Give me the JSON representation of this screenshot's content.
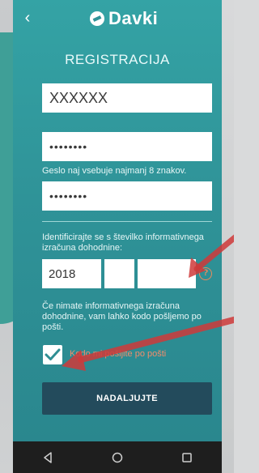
{
  "app": {
    "logo_text": "Davki",
    "screen_title": "REGISTRACIJA"
  },
  "form": {
    "username_value": "XXXXXX",
    "password_value": "••••••••",
    "password_hint": "Geslo naj vsebuje najmanj 8 znakov.",
    "password_repeat_value": "••••••••",
    "identify_text": "Identificirajte se s številko informativnega izračuna dohodnine:",
    "year_value": "2018",
    "code_part_small_value": "",
    "code_part_mid_value": "",
    "help_icon_glyph": "?",
    "note_text": "Če nimate informativnega izračuna dohodnine, vam lahko kodo pošljemo po pošti.",
    "checkbox_checked": true,
    "checkbox_label": "Kodo mi pošljite po pošti",
    "continue_label": "NADALJUJTE"
  },
  "colors": {
    "accent_teal": "#2f9398",
    "button_dark": "#234b5c",
    "label_orange": "#f28c6b",
    "annotation_red": "#cf3a3a"
  },
  "icons": {
    "back": "back-icon",
    "help": "help-icon",
    "check": "check-icon",
    "nav_back": "nav-back-icon",
    "nav_home": "nav-home-icon",
    "nav_recents": "nav-recents-icon"
  }
}
